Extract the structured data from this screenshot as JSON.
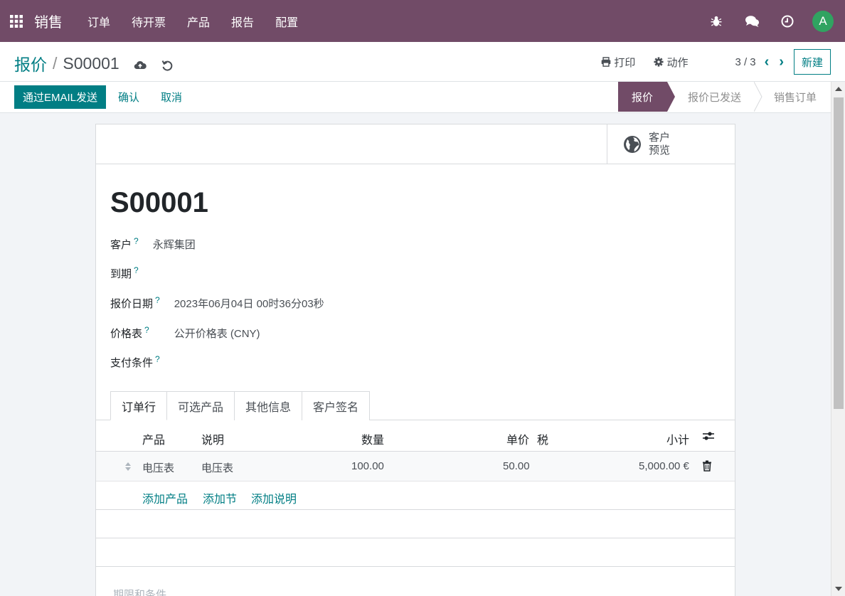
{
  "navbar": {
    "app_name": "销售",
    "menu": [
      "订单",
      "待开票",
      "产品",
      "报告",
      "配置"
    ],
    "avatar_letter": "A",
    "bg_color": "#714b67"
  },
  "control": {
    "breadcrumb_parent": "报价",
    "breadcrumb_sep": "/",
    "breadcrumb_current": "S00001",
    "print_label": "打印",
    "action_label": "动作",
    "pager": "3 / 3",
    "new_label": "新建"
  },
  "statusbar": {
    "send_email_label": "通过EMAIL发送",
    "confirm_label": "确认",
    "cancel_label": "取消",
    "stages": [
      "报价",
      "报价已发送",
      "销售订单"
    ],
    "active_stage": "报价"
  },
  "sheet": {
    "preview_label_1": "客户",
    "preview_label_2": "预览",
    "title": "S00001",
    "fields": {
      "customer_label": "客户",
      "customer_value": "永辉集团",
      "expiry_label": "到期",
      "expiry_value": "",
      "quote_date_label": "报价日期",
      "quote_date_value": "2023年06月04日 00时36分03秒",
      "pricelist_label": "价格表",
      "pricelist_value": "公开价格表 (CNY)",
      "payment_terms_label": "支付条件",
      "payment_terms_value": ""
    },
    "help_mark": "?",
    "tabs": [
      "订单行",
      "可选产品",
      "其他信息",
      "客户签名"
    ],
    "table": {
      "headers": {
        "product": "产品",
        "description": "说明",
        "quantity": "数量",
        "unit_price": "单价",
        "tax": "税",
        "subtotal": "小计"
      },
      "rows": [
        {
          "product": "电压表",
          "description": "电压表",
          "quantity": "100.00",
          "unit_price": "50.00",
          "subtotal": "5,000.00 €"
        }
      ],
      "add_product": "添加产品",
      "add_section": "添加节",
      "add_note": "添加说明"
    },
    "terms_placeholder": "期限和条件..."
  }
}
